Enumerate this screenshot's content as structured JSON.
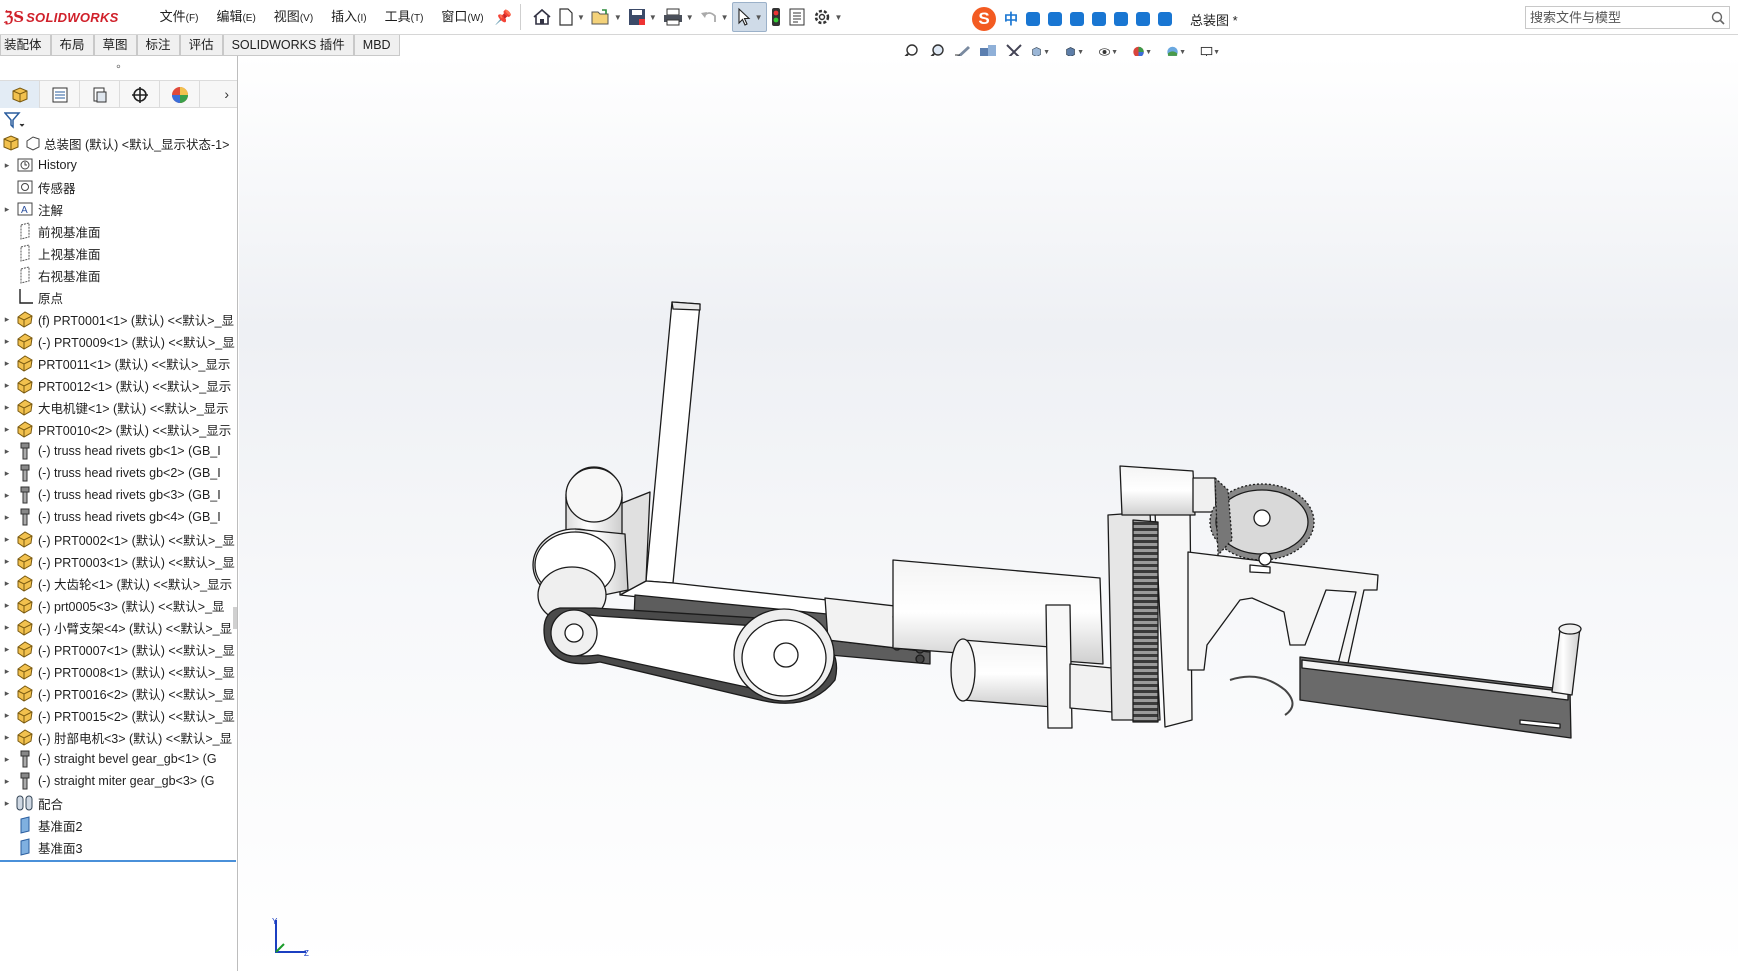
{
  "app": {
    "brand": "SOLIDWORKS",
    "document_title": "总装图 *",
    "accent_color": "#d0202a"
  },
  "menus": [
    {
      "label": "文件",
      "shortcut": "(F)"
    },
    {
      "label": "编辑",
      "shortcut": "(E)"
    },
    {
      "label": "视图",
      "shortcut": "(V)"
    },
    {
      "label": "插入",
      "shortcut": "(I)"
    },
    {
      "label": "工具",
      "shortcut": "(T)"
    },
    {
      "label": "窗口",
      "shortcut": "(W)"
    }
  ],
  "toolbar_icons": [
    "home-icon",
    "new-document-icon",
    "open-icon",
    "save-icon",
    "print-icon",
    "undo-icon",
    "select-icon",
    "rebuild-icon",
    "file-properties-icon",
    "options-icon"
  ],
  "ime": {
    "logo": "S",
    "mode": "中",
    "icons": [
      "punctuation-icon",
      "microphone-icon",
      "keyboard-icon",
      "skin-icon",
      "game-icon",
      "toolbox-icon",
      "settings-icon"
    ]
  },
  "search": {
    "placeholder": "搜索文件与模型"
  },
  "command_tabs": [
    "装配体",
    "布局",
    "草图",
    "标注",
    "评估",
    "SOLIDWORKS 插件",
    "MBD"
  ],
  "heads_up_icons": [
    "zoom-to-fit-icon",
    "zoom-to-area-icon",
    "previous-view-icon",
    "section-view-icon",
    "dynamic-annotation-icon",
    "view-orientation-icon",
    "display-style-icon",
    "hide-show-items-icon",
    "edit-appearance-icon",
    "apply-scene-icon",
    "view-settings-icon"
  ],
  "panel": {
    "tabs": [
      "featuremanager-tab",
      "propertymanager-tab",
      "configurationmanager-tab",
      "dimxpert-tab",
      "displaymanager-tab"
    ],
    "more": "›"
  },
  "tree": {
    "root": {
      "label": "总装图 (默认) <默认_显示状态-1>",
      "icon": "assembly-icon"
    },
    "items": [
      {
        "label": "History",
        "icon": "history-icon",
        "expandable": true
      },
      {
        "label": "传感器",
        "icon": "sensor-icon",
        "expandable": false
      },
      {
        "label": "注解",
        "icon": "annotation-icon",
        "expandable": true
      },
      {
        "label": "前视基准面",
        "icon": "plane-icon",
        "expandable": false
      },
      {
        "label": "上视基准面",
        "icon": "plane-icon",
        "expandable": false
      },
      {
        "label": "右视基准面",
        "icon": "plane-icon",
        "expandable": false
      },
      {
        "label": "原点",
        "icon": "origin-icon",
        "expandable": false
      },
      {
        "label": "(f) PRT0001<1> (默认) <<默认>_显",
        "icon": "part-icon",
        "expandable": true
      },
      {
        "label": "(-) PRT0009<1> (默认) <<默认>_显",
        "icon": "part-icon",
        "expandable": true
      },
      {
        "label": "PRT0011<1> (默认) <<默认>_显示",
        "icon": "part-icon",
        "expandable": true
      },
      {
        "label": "PRT0012<1> (默认) <<默认>_显示",
        "icon": "part-icon",
        "expandable": true
      },
      {
        "label": "大电机键<1> (默认) <<默认>_显示",
        "icon": "part-icon",
        "expandable": true
      },
      {
        "label": "PRT0010<2> (默认) <<默认>_显示",
        "icon": "part-icon",
        "expandable": true
      },
      {
        "label": "(-) truss head rivets gb<1> (GB_I",
        "icon": "toolbox-part-icon",
        "expandable": true
      },
      {
        "label": "(-) truss head rivets gb<2> (GB_I",
        "icon": "toolbox-part-icon",
        "expandable": true
      },
      {
        "label": "(-) truss head rivets gb<3> (GB_I",
        "icon": "toolbox-part-icon",
        "expandable": true
      },
      {
        "label": "(-) truss head rivets gb<4> (GB_I",
        "icon": "toolbox-part-icon",
        "expandable": true
      },
      {
        "label": "(-) PRT0002<1> (默认) <<默认>_显",
        "icon": "part-icon",
        "expandable": true
      },
      {
        "label": "(-) PRT0003<1> (默认) <<默认>_显",
        "icon": "part-icon",
        "expandable": true
      },
      {
        "label": "(-) 大齿轮<1> (默认) <<默认>_显示",
        "icon": "part-icon",
        "expandable": true
      },
      {
        "label": "(-) prt0005<3> (默认) <<默认>_显",
        "icon": "part-icon",
        "expandable": true
      },
      {
        "label": "(-) 小臂支架<4> (默认) <<默认>_显",
        "icon": "part-icon",
        "expandable": true
      },
      {
        "label": "(-) PRT0007<1> (默认) <<默认>_显",
        "icon": "part-icon",
        "expandable": true
      },
      {
        "label": "(-) PRT0008<1> (默认) <<默认>_显",
        "icon": "part-icon",
        "expandable": true
      },
      {
        "label": "(-) PRT0016<2> (默认) <<默认>_显",
        "icon": "part-icon",
        "expandable": true
      },
      {
        "label": "(-) PRT0015<2> (默认) <<默认>_显",
        "icon": "part-icon",
        "expandable": true
      },
      {
        "label": "(-) 肘部电机<3> (默认) <<默认>_显",
        "icon": "part-icon",
        "expandable": true
      },
      {
        "label": "(-) straight bevel gear_gb<1> (G",
        "icon": "toolbox-part-icon",
        "expandable": true
      },
      {
        "label": "(-) straight miter gear_gb<3> (G",
        "icon": "toolbox-part-icon",
        "expandable": true
      },
      {
        "label": "配合",
        "icon": "mates-icon",
        "expandable": true
      },
      {
        "label": "基准面2",
        "icon": "plane-feature-icon",
        "expandable": false
      },
      {
        "label": "基准面3",
        "icon": "plane-feature-icon",
        "expandable": false
      }
    ]
  },
  "graphics": {
    "model": "robot-arm-assembly",
    "triad_axes": [
      "Y",
      "Z"
    ]
  }
}
